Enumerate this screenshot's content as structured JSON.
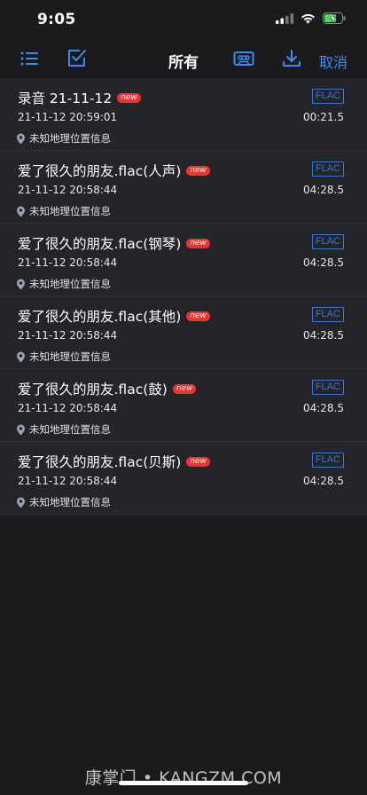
{
  "status_bar": {
    "time": "9:05"
  },
  "toolbar": {
    "title": "所有",
    "cancel_label": "取消"
  },
  "colors": {
    "accent": "#3a8cf2",
    "badge": "#e8352f",
    "format_tag": "#3a78d0",
    "background": "#1b1b1d",
    "row": "#242528"
  },
  "recordings": [
    {
      "name": "录音 21-11-12",
      "badge": "new",
      "format": "FLAC",
      "date": "21-11-12 20:59:01",
      "duration": "00:21.5",
      "location": "未知地理位置信息"
    },
    {
      "name": "爱了很久的朋友.flac(人声)",
      "badge": "new",
      "format": "FLAC",
      "date": "21-11-12 20:58:44",
      "duration": "04:28.5",
      "location": "未知地理位置信息"
    },
    {
      "name": "爱了很久的朋友.flac(钢琴)",
      "badge": "new",
      "format": "FLAC",
      "date": "21-11-12 20:58:44",
      "duration": "04:28.5",
      "location": "未知地理位置信息"
    },
    {
      "name": "爱了很久的朋友.flac(其他)",
      "badge": "new",
      "format": "FLAC",
      "date": "21-11-12 20:58:44",
      "duration": "04:28.5",
      "location": "未知地理位置信息"
    },
    {
      "name": "爱了很久的朋友.flac(鼓)",
      "badge": "new",
      "format": "FLAC",
      "date": "21-11-12 20:58:44",
      "duration": "04:28.5",
      "location": "未知地理位置信息"
    },
    {
      "name": "爱了很久的朋友.flac(贝斯)",
      "badge": "new",
      "format": "FLAC",
      "date": "21-11-12 20:58:44",
      "duration": "04:28.5",
      "location": "未知地理位置信息"
    }
  ],
  "watermark": "康掌门 • KANGZM.COM"
}
